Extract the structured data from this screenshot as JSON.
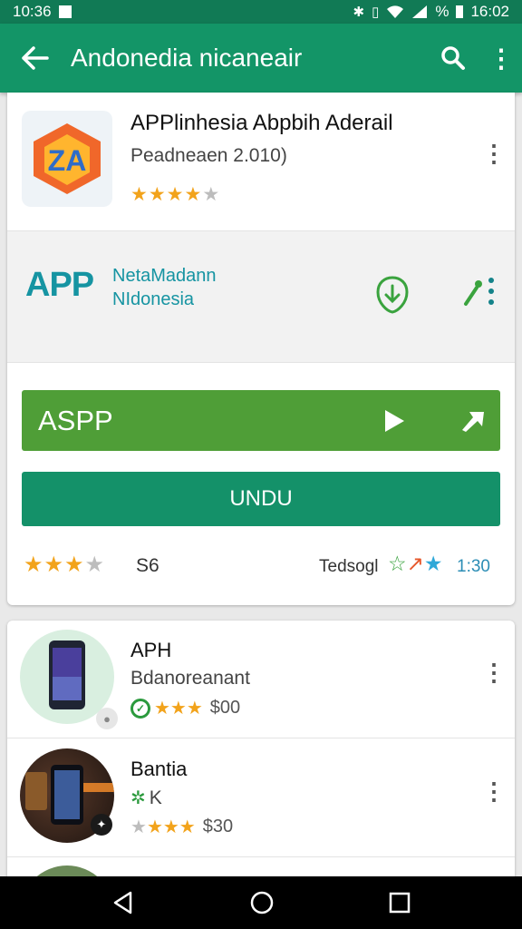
{
  "status_bar": {
    "time": "10:36",
    "battery": "%",
    "clock": "16:02"
  },
  "app_bar": {
    "title": "Andonedia nicaneair",
    "back_icon": "arrow-left-icon",
    "search_icon": "search-icon",
    "menu_icon": "more-vert-icon"
  },
  "featured": {
    "app_title": "APPlinhesia Abpbih Aderail",
    "app_subtitle": "Peadneaen 2.010)",
    "rating_stars": 3.5,
    "banner": {
      "logo": "APP",
      "line1": "NetaMadann",
      "line2": "NIdonesia"
    },
    "play_button_label": "ASPP",
    "download_button_label": "UNDU",
    "rating_count": "S6",
    "rating_label": "Tedsogl",
    "rating_number": "1:30",
    "bottom_stars": 3
  },
  "list": [
    {
      "title": "APH",
      "subtitle": "Bdanoreanant",
      "stars": 3,
      "price": "$00"
    },
    {
      "title": "Bantia",
      "subtitle": "K",
      "stars": 3,
      "price": "$30"
    }
  ],
  "colors": {
    "appbar": "#139567",
    "statusbar": "#117a55",
    "play_button": "#4f9e37",
    "download_button": "#149169",
    "star": "#f2a31b"
  }
}
